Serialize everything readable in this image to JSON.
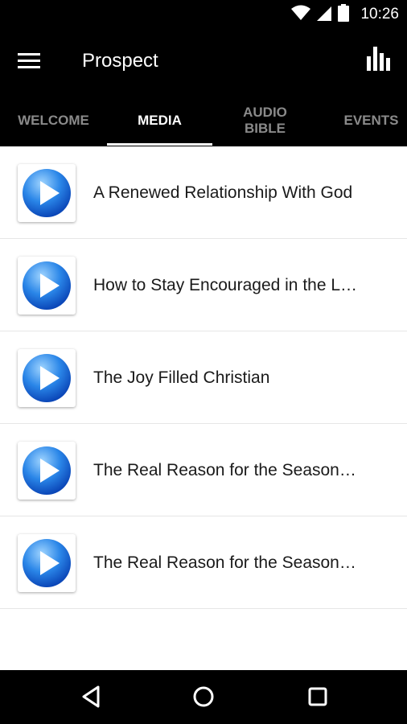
{
  "status_bar": {
    "time": "10:26",
    "icons": [
      "wifi-icon",
      "signal-icon",
      "battery-icon"
    ]
  },
  "app_bar": {
    "title": "Prospect",
    "menu_icon": "hamburger-menu-icon",
    "action_icon": "bar-chart-icon"
  },
  "tabs": [
    {
      "label": "WELCOME",
      "active": false
    },
    {
      "label": "MEDIA",
      "active": true
    },
    {
      "label": "AUDIO BIBLE",
      "active": false
    },
    {
      "label": "EVENTS",
      "active": false
    }
  ],
  "media_items": [
    {
      "title": "A Renewed Relationship With God",
      "icon": "play-icon"
    },
    {
      "title": "How to Stay Encouraged in the L…",
      "icon": "play-icon"
    },
    {
      "title": "The Joy Filled Christian",
      "icon": "play-icon"
    },
    {
      "title": "The Real Reason for the Season…",
      "icon": "play-icon"
    },
    {
      "title": "The Real Reason for the Season…",
      "icon": "play-icon"
    }
  ],
  "nav_bar": {
    "icons": [
      "back-icon",
      "home-icon",
      "recents-icon"
    ]
  },
  "colors": {
    "bar_background": "#000000",
    "active_tab": "#ffffff",
    "inactive_tab": "#8a8a8a",
    "play_blue": "#1e7fe0"
  }
}
